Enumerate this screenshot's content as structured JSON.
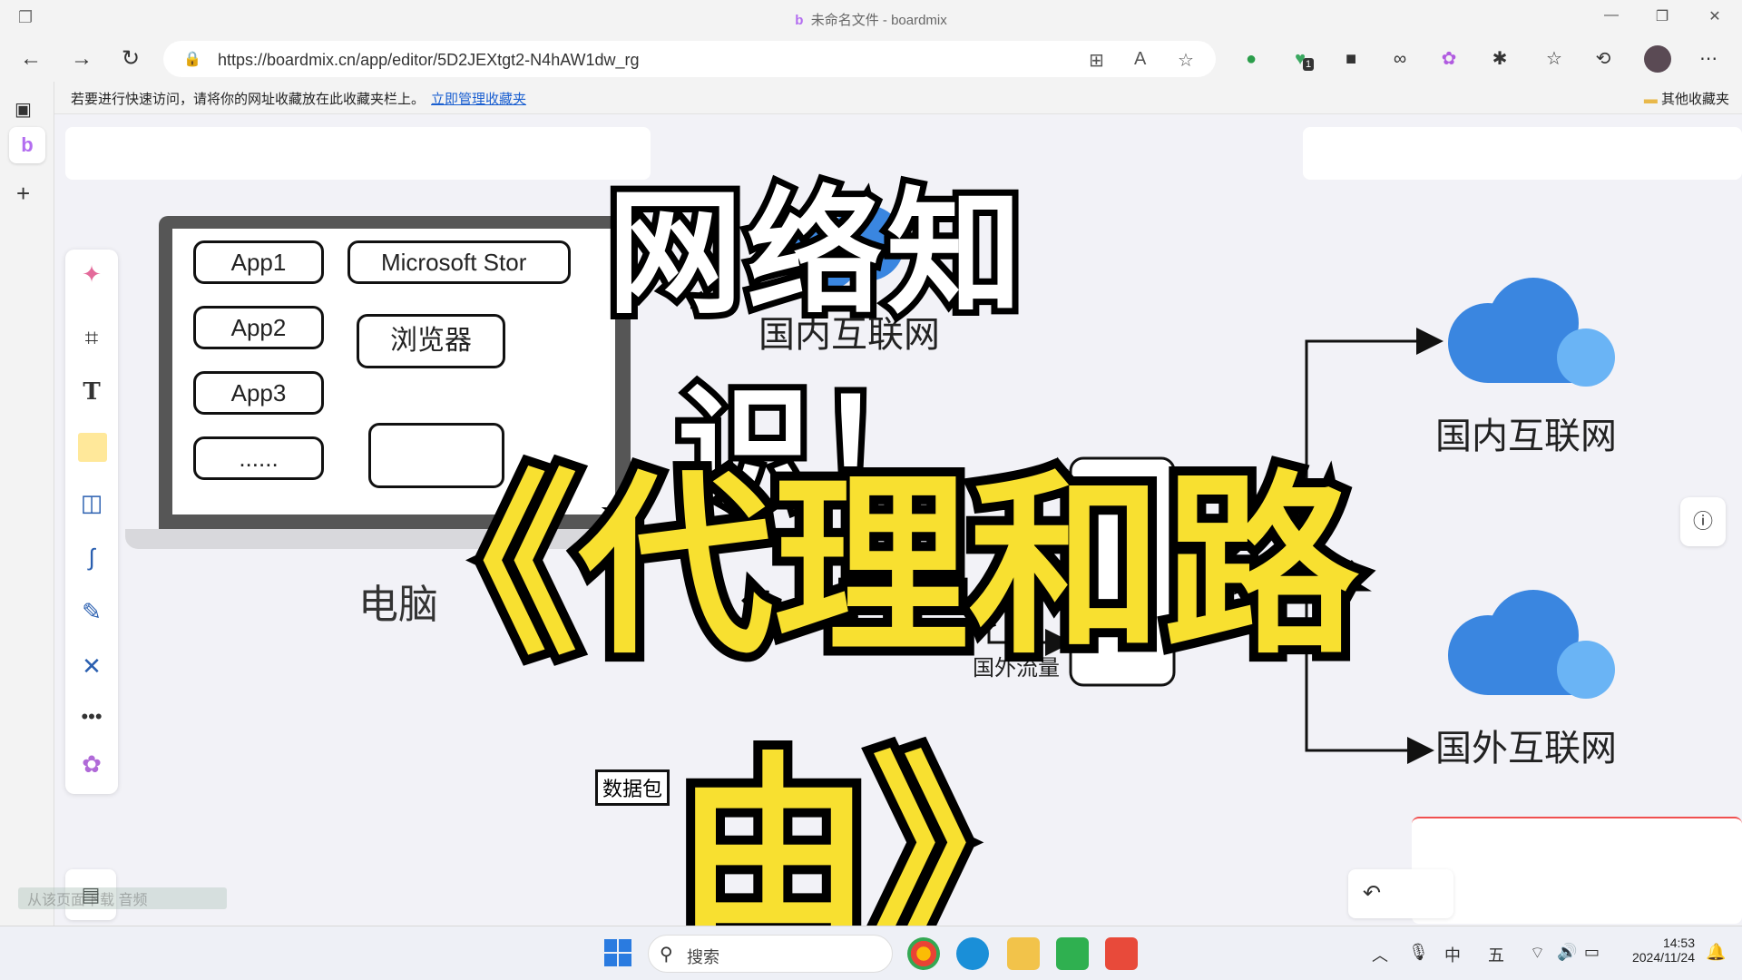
{
  "browser": {
    "tab_title": "未命名文件 - boardmix",
    "url": "https://boardmix.cn/app/editor/5D2JEXtgt2-N4hAW1dw_rg",
    "bookmarks_hint": "若要进行快速访问，请将你的网址收藏放在此收藏夹栏上。",
    "bookmarks_manage": "立即管理收藏夹",
    "other_favorites": "其他收藏夹",
    "extension_badge": "1"
  },
  "headline": {
    "line1": "网络知识！",
    "line2": "《代理和路由》"
  },
  "diagram": {
    "apps": [
      "App1",
      "App2",
      "App3",
      "......"
    ],
    "microsoft_store": "Microsoft Stor",
    "browser_box": "浏览器",
    "top_label": "国内互联网",
    "domestic_internet": "国内互联网",
    "foreign_internet": "国外互联网",
    "foreign_traffic": "国外流量",
    "data_packet": "数据包",
    "partial_computer": "电脑"
  },
  "overlay_text": "从该页面下载 音频",
  "taskbar": {
    "search_placeholder": "搜索",
    "ime_lang": "中",
    "ime_mode": "五",
    "time": "14:53",
    "date": "2024/11/24"
  },
  "colors": {
    "headline_yellow": "#f8e030",
    "cloud_blue": "#3a86e0",
    "cloud_light": "#6ab4f5",
    "link_blue": "#1a5fd0"
  }
}
